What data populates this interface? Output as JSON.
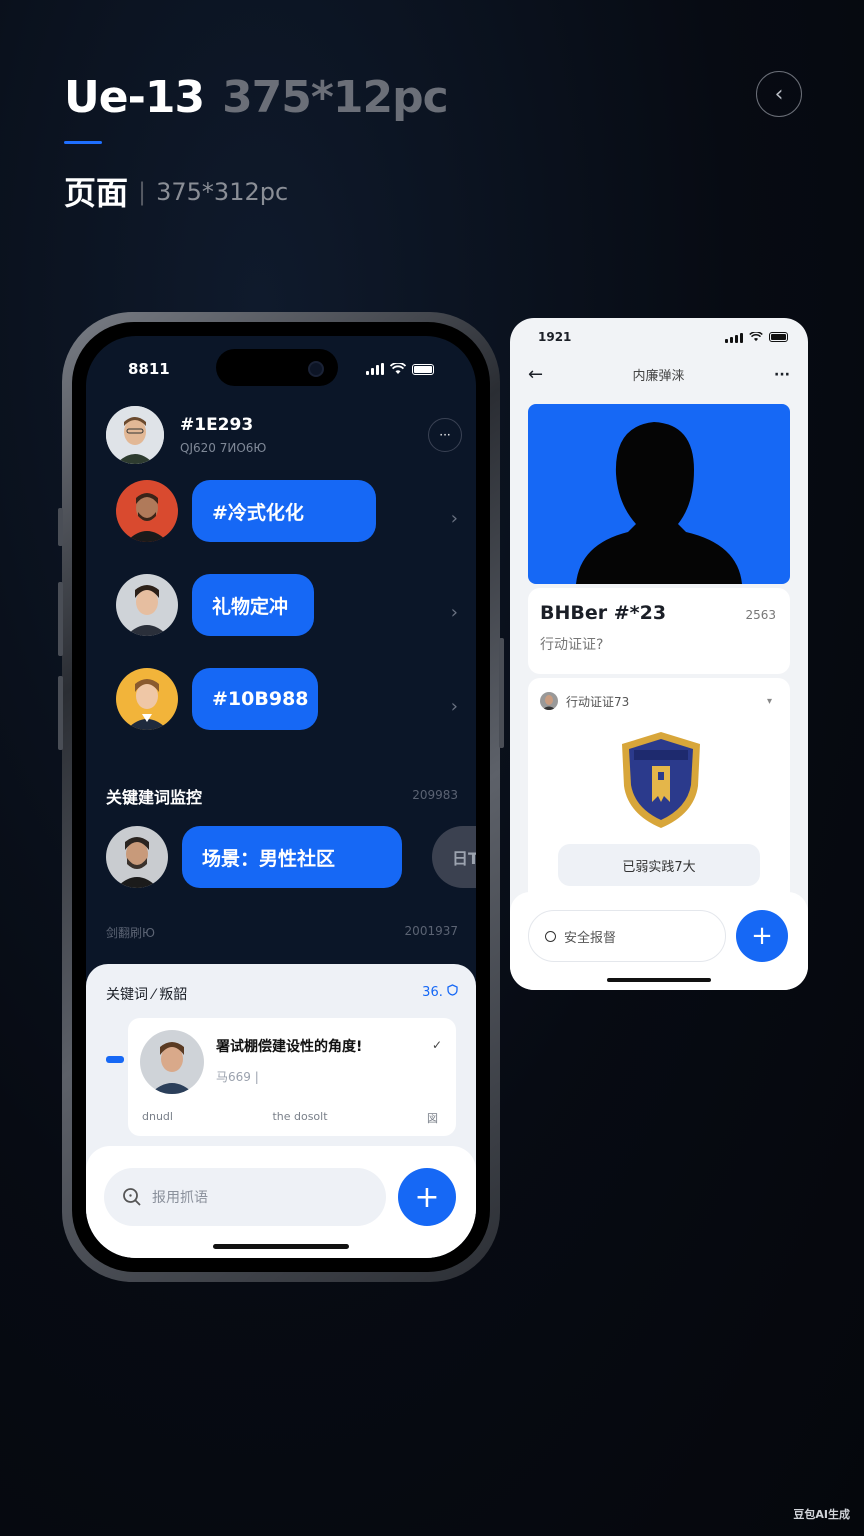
{
  "header": {
    "title": "Ue-13",
    "title_spec": "375*12pc",
    "subtitle": "页面",
    "subtitle_spec": "375*312pc",
    "back_icon": "‹"
  },
  "phone_main": {
    "status": {
      "time": "8811"
    },
    "profile": {
      "name": "#1E293",
      "sub": "QJ620 7ИО6Ю"
    },
    "more_icon": "···",
    "messages": [
      {
        "label": "#冷式化化",
        "chev": "›"
      },
      {
        "label": "礼物定冲",
        "chev": "›"
      },
      {
        "label": "#10B988",
        "chev": "›"
      }
    ],
    "keyword_section": {
      "title": "关键建词监控",
      "count": "209983"
    },
    "scene_bubble": "场景：男性社区",
    "ghost_pill": "日T",
    "meta": {
      "left": "剑翻刷Ю",
      "right": "2001937"
    },
    "card": {
      "title": "关键词 ⁄ 叛韶",
      "right": "36.",
      "post_text": "署试棚偿建设性的角度!",
      "post_sub": "马669 |",
      "post_check": "✓",
      "foot_left": "dnudl",
      "foot_mid": "the dosolt",
      "foot_right": "図"
    },
    "search_placeholder": "报用抓语",
    "fab_icon": "+"
  },
  "phone_detail": {
    "status": {
      "time": "1921"
    },
    "back_icon": "←",
    "nav_title": "内廉弹涞",
    "more_icon": "···",
    "name": "BHBer #*23",
    "number": "2563",
    "sub": "行动证证?",
    "badge_head": "行动证证73",
    "badge_caret": "▾",
    "badge_pill": "已弱实践7大",
    "search_label": "安全报督",
    "fab_icon": "+"
  },
  "watermark": "豆包AI生成",
  "colors": {
    "accent": "#1668f5",
    "bg": "#070b13",
    "screen": "#0b1628"
  }
}
